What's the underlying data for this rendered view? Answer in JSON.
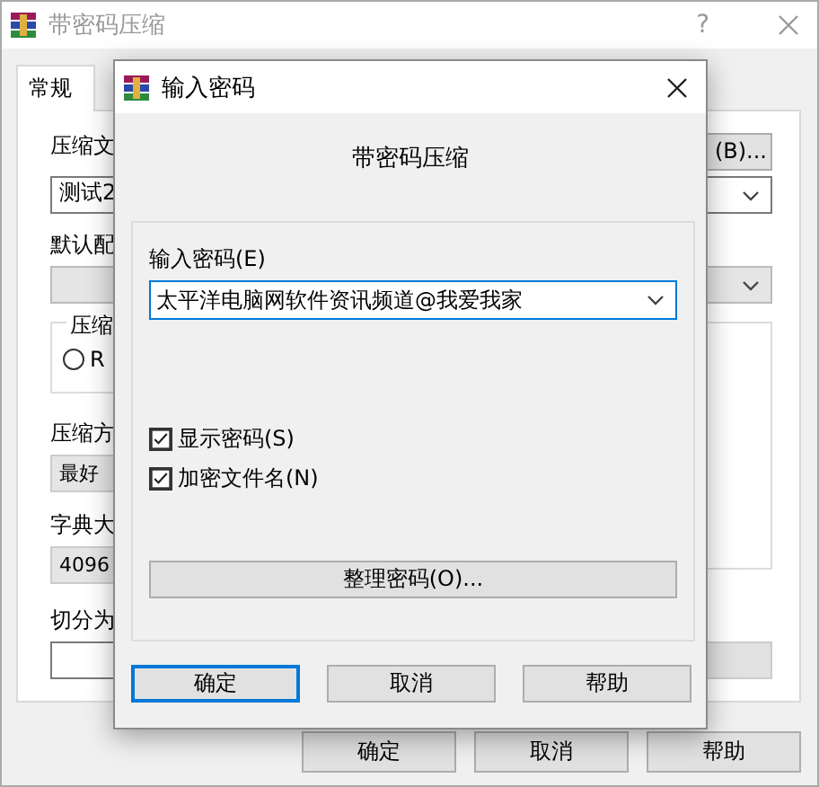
{
  "window": {
    "title": "带密码压缩",
    "help": "?"
  },
  "tabs": [
    {
      "label": "常规",
      "selected": true
    }
  ],
  "general": {
    "archive_label": "压缩文",
    "browse_button": "(B)...",
    "archive_name": "测试2",
    "profile_label": "默认配",
    "format_group": {
      "legend": "压缩",
      "options": [
        {
          "label": "R",
          "selected": false
        }
      ]
    },
    "method_label": "压缩方",
    "method": "最好",
    "dictionary_label": "字典大",
    "dictionary": "4096",
    "split_label": "切分为"
  },
  "buttons": [
    {
      "label": "确定"
    },
    {
      "label": "取消"
    },
    {
      "label": "帮助"
    }
  ],
  "dialog": {
    "title": "输入密码",
    "heading": "带密码压缩",
    "password_label": "输入密码(E)",
    "password": "太平洋电脑网软件资讯频道@我爱我家",
    "options": [
      {
        "label": "显示密码(S)",
        "checked": true
      },
      {
        "label": "加密文件名(N)",
        "checked": true
      }
    ],
    "organize_button": "整理密码(O)...",
    "buttons": [
      {
        "label": "确定",
        "default": true
      },
      {
        "label": "取消",
        "default": false
      },
      {
        "label": "帮助",
        "default": false
      }
    ]
  }
}
